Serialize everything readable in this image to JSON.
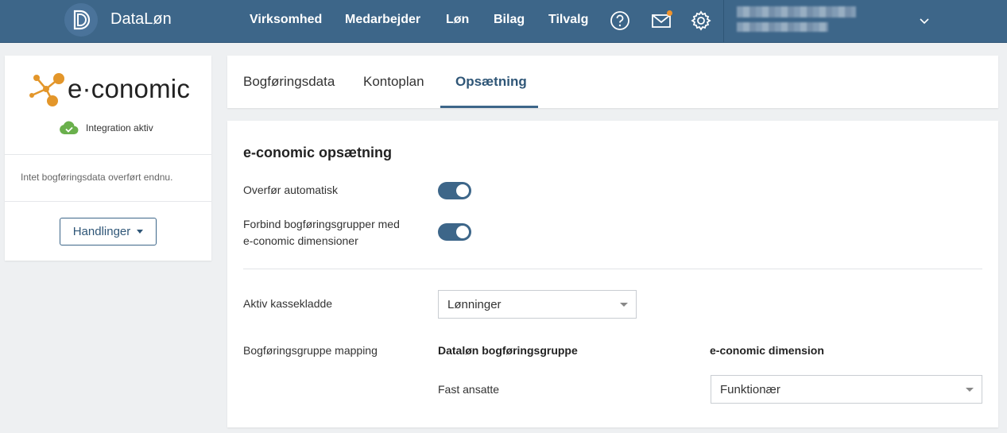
{
  "header": {
    "brand": "DataLøn",
    "nav": [
      "Virksomhed",
      "Medarbejder",
      "Løn",
      "Bilag",
      "Tilvalg"
    ],
    "icons": [
      "help-icon",
      "mail-icon",
      "gear-icon",
      "chevron-down-icon"
    ],
    "colors": {
      "bar": "#3d6689",
      "notification": "#f0932b"
    }
  },
  "sidebar": {
    "logo_text": "e·conomic",
    "status": "Integration aktiv",
    "status_color": "#6ab04c",
    "no_data_text": "Intet bogføringsdata overført endnu.",
    "actions_button": "Handlinger"
  },
  "tabs": {
    "items": [
      "Bogføringsdata",
      "Kontoplan",
      "Opsætning"
    ],
    "active": "Opsætning"
  },
  "settings": {
    "title": "e-conomic opsætning",
    "auto_transfer_label": "Overfør automatisk",
    "auto_transfer_on": true,
    "connect_label_line1": "Forbind bogføringsgrupper med",
    "connect_label_line2": "e-conomic dimensioner",
    "connect_on": true,
    "cashbook_label": "Aktiv kassekladde",
    "cashbook_value": "Lønninger",
    "mapping_label": "Bogføringsgruppe mapping",
    "col_group": "Dataløn bogføringsgruppe",
    "col_dimension": "e-conomic dimension",
    "rows": [
      {
        "group": "Fast ansatte",
        "dimension": "Funktionær"
      }
    ]
  }
}
